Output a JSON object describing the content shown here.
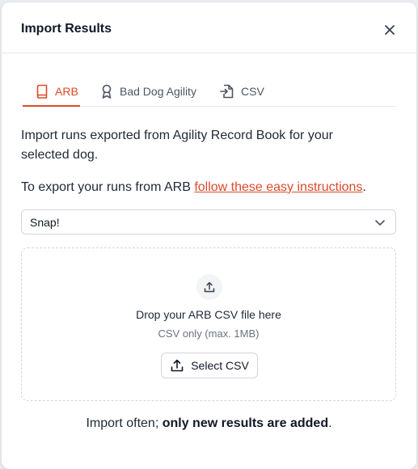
{
  "dialog": {
    "title": "Import Results",
    "close_icon": "x-icon"
  },
  "tabs": [
    {
      "label": "ARB",
      "icon": "book-icon",
      "active": true
    },
    {
      "label": "Bad Dog Agility",
      "icon": "award-ribbon-icon",
      "active": false
    },
    {
      "label": "CSV",
      "icon": "file-import-icon",
      "active": false
    }
  ],
  "content": {
    "intro": "Import runs exported from Agility Record Book for your selected dog.",
    "instructions_prefix": "To export your runs from ARB ",
    "instructions_link": "follow these easy instructions",
    "instructions_suffix": "."
  },
  "dog_select": {
    "value": "Snap!"
  },
  "dropzone": {
    "title": "Drop your ARB CSV file here",
    "subtitle": "CSV only (max. 1MB)",
    "button_label": "Select CSV"
  },
  "footer": {
    "prefix": "Import often; ",
    "bold": "only new results are added",
    "suffix": "."
  },
  "colors": {
    "accent": "#dc4a2a",
    "border": "#e5e7eb",
    "text": "#1f2937",
    "muted": "#6b7280"
  }
}
